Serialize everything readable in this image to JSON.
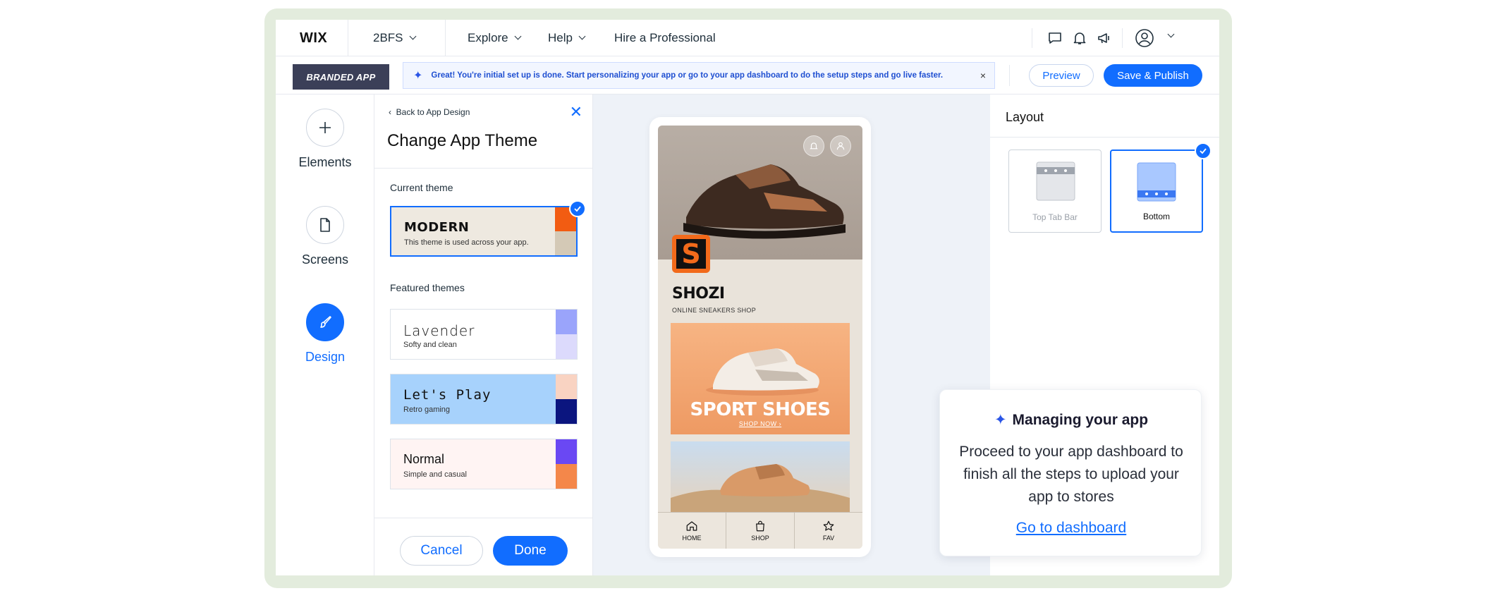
{
  "topbar": {
    "logo": "WIX",
    "site_name": "2BFS",
    "nav": [
      {
        "label": "Explore"
      },
      {
        "label": "Help"
      },
      {
        "label": "Hire a Professional"
      }
    ]
  },
  "subbar": {
    "branded_label": "BRANDED APP",
    "banner_text": "Great! You're initial set up is done. Start personalizing your app or go to your app dashboard to do the setup  steps and  go live faster.",
    "banner_close": "×",
    "preview_label": "Preview",
    "publish_label": "Save & Publish"
  },
  "rail": {
    "items": [
      {
        "label": "Elements"
      },
      {
        "label": "Screens"
      },
      {
        "label": "Design"
      }
    ]
  },
  "panel": {
    "back_label": "Back to App Design",
    "title": "Change App Theme",
    "current_label": "Current theme",
    "current_theme": {
      "name": "MODERN",
      "desc": "This theme is used across your app.",
      "colors": [
        "#f25c12",
        "#d4c9b6"
      ]
    },
    "featured_label": "Featured themes",
    "featured": [
      {
        "name": "Lavender",
        "desc": "Softy and clean",
        "colors": [
          "#9aa4fb",
          "#dcdafc"
        ],
        "bg": "#ffffff"
      },
      {
        "name": "Let's Play",
        "desc": "Retro gaming",
        "colors": [
          "#f9d3c2",
          "#0b157f"
        ],
        "bg": "#a7d2fc"
      },
      {
        "name": "Normal",
        "desc": "Simple and casual",
        "colors": [
          "#6a48f3",
          "#f4874a"
        ],
        "bg": "#fff4f3"
      }
    ],
    "cancel_label": "Cancel",
    "done_label": "Done"
  },
  "phone": {
    "logo_letter": "S",
    "shop_name": "SHOZI",
    "shop_sub": "ONLINE SNEAKERS SHOP",
    "promo_title": "SPORT SHOES",
    "promo_sub": "SHOP NOW ›",
    "tabs": [
      {
        "label": "HOME"
      },
      {
        "label": "SHOP"
      },
      {
        "label": "FAV"
      }
    ]
  },
  "layout": {
    "title": "Layout",
    "options": [
      {
        "label": "Top Tab Bar"
      },
      {
        "label": "Bottom"
      }
    ]
  },
  "manage": {
    "title": "Managing your app",
    "body": "Proceed to your app dashboard to finish all the steps to upload your app to stores",
    "link": "Go to dashboard"
  },
  "colors": {
    "accent": "#116dff",
    "frame": "#e3ecdd",
    "branded_bg": "#3b3f58"
  },
  "icons": [
    "chat-icon",
    "bell-icon",
    "megaphone-icon",
    "account-icon",
    "plus-icon",
    "page-icon",
    "brush-icon",
    "sparkle-icon",
    "home-icon",
    "bag-icon",
    "star-icon"
  ]
}
